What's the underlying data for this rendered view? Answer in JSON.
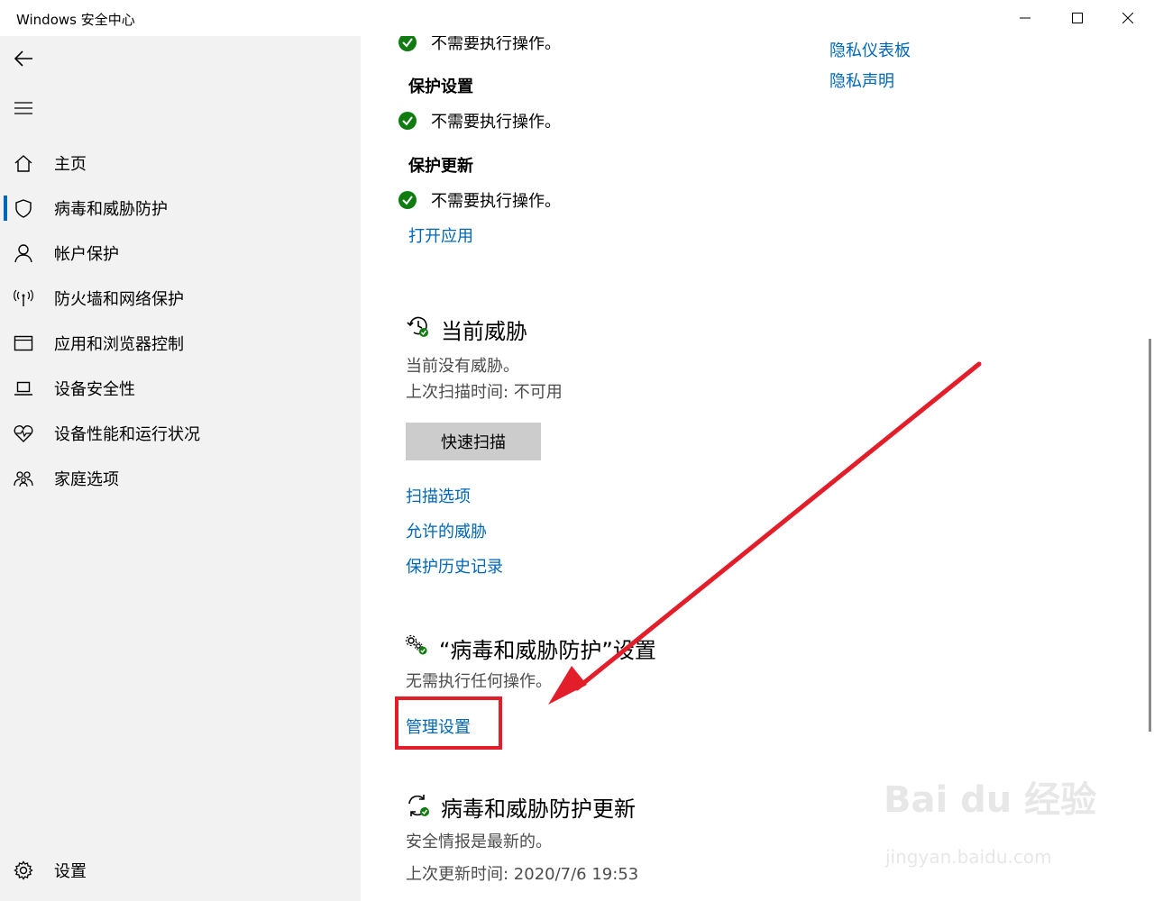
{
  "window": {
    "title": "Windows 安全中心"
  },
  "sidebar": {
    "items": [
      {
        "label": "主页",
        "icon": "home-icon"
      },
      {
        "label": "病毒和威胁防护",
        "icon": "shield-icon",
        "active": true
      },
      {
        "label": "帐户保护",
        "icon": "person-icon"
      },
      {
        "label": "防火墙和网络保护",
        "icon": "antenna-icon"
      },
      {
        "label": "应用和浏览器控制",
        "icon": "app-window-icon"
      },
      {
        "label": "设备安全性",
        "icon": "laptop-icon"
      },
      {
        "label": "设备性能和运行状况",
        "icon": "heart-pulse-icon"
      },
      {
        "label": "家庭选项",
        "icon": "family-icon"
      }
    ],
    "settings_label": "设置"
  },
  "main": {
    "top_status_partial": "不需要执行操作。",
    "protection_settings": {
      "heading": "保护设置",
      "status": "不需要执行操作。"
    },
    "protection_updates": {
      "heading": "保护更新",
      "status": "不需要执行操作。"
    },
    "open_app_link": "打开应用",
    "privacy_links": [
      "隐私仪表板",
      "隐私声明"
    ],
    "current_threats": {
      "title": "当前威胁",
      "line1": "当前没有威胁。",
      "line2": "上次扫描时间: 不可用",
      "quick_scan_button": "快速扫描",
      "links": [
        "扫描选项",
        "允许的威胁",
        "保护历史记录"
      ]
    },
    "vtp_settings": {
      "title": "“病毒和威胁防护”设置",
      "desc": "无需执行任何操作。",
      "manage_link": "管理设置"
    },
    "vtp_updates": {
      "title": "病毒和威胁防护更新",
      "line1": "安全情报是最新的。",
      "line2": "上次更新时间: 2020/7/6 19:53"
    }
  },
  "annotation": {
    "color": "#e31e2b"
  },
  "watermark": {
    "logo": "Bai du 经验",
    "url": "jingyan.baidu.com"
  },
  "colors": {
    "accent": "#0067b8",
    "success": "#107c10",
    "sidebar_bg": "#f2f2f2"
  }
}
